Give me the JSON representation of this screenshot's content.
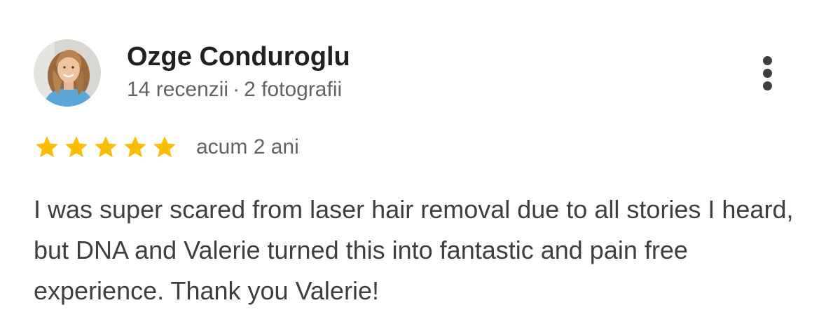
{
  "review": {
    "author": {
      "name": "Ozge Conduroglu",
      "reviews_count": "14 recenzii",
      "separator": "·",
      "photos_count": "2 fotografii",
      "avatar_icon": "person-photo"
    },
    "rating": {
      "stars": 5,
      "max_stars": 5,
      "star_color": "#fbbc04",
      "time_ago": "acum 2 ani"
    },
    "text": "I was super scared from laser hair removal due to all stories I heard, but DNA and Valerie turned this into fantastic and pain free experience. Thank you Valerie!",
    "more_options_icon": "more-vertical-icon"
  }
}
